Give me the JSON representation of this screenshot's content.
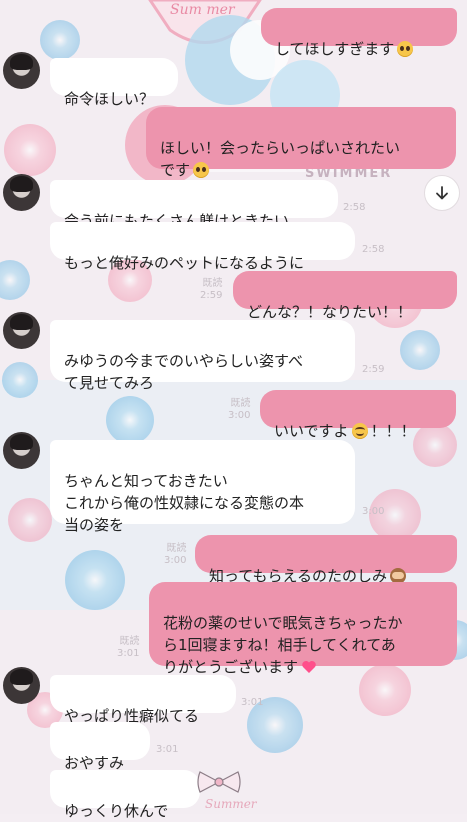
{
  "background": {
    "sticker_text_1": "Sum mer",
    "sticker_text_2": "SWIMMER",
    "sticker_text_3": "Summer"
  },
  "chat": {
    "messages": [
      {
        "id": "m1",
        "side": "out",
        "text": "してほしすぎます",
        "emoji": "pleading-face-icon"
      },
      {
        "id": "m2",
        "side": "in",
        "text": "命令ほしい？"
      },
      {
        "id": "m3",
        "side": "out",
        "text": "ほしい！会ったらいっぱいされたい\nです",
        "emoji": "pleading-face-icon"
      },
      {
        "id": "m4",
        "side": "in",
        "text": "会う前にもたくさん躾けときたい",
        "time": "2:58"
      },
      {
        "id": "m5",
        "side": "in",
        "text": "もっと俺好みのペットになるように",
        "time": "2:58"
      },
      {
        "id": "m6",
        "side": "out",
        "text": "どんな？！なりたい！！",
        "read": "既読",
        "time": "2:59"
      },
      {
        "id": "m7",
        "side": "in",
        "text": "みゆうの今までのいやらしい姿すべ\nて見せてみろ",
        "time": "2:59"
      },
      {
        "id": "m8",
        "side": "out",
        "text": "いいですよ",
        "emoji": "smiling-face-icon",
        "text_after": "！！！",
        "read": "既読",
        "time": "3:00"
      },
      {
        "id": "m9",
        "side": "in",
        "text": "ちゃんと知っておきたい\nこれから俺の性奴隷になる変態の本\n当の姿を",
        "time": "3:00"
      },
      {
        "id": "m10",
        "side": "out",
        "text": "知ってもらえるのたのしみ",
        "emoji": "see-no-evil-monkey-icon",
        "read": "既読",
        "time": "3:00"
      },
      {
        "id": "m11",
        "side": "out",
        "text": "花粉の薬のせいで眠気きちゃったか\nら1回寝ますね！相手してくれてあ\nりがとうございます",
        "emoji": "pink-heart-icon",
        "read": "既読",
        "time": "3:01"
      },
      {
        "id": "m12",
        "side": "in",
        "text": "やっぱり性癖似てる",
        "time": "3:01"
      },
      {
        "id": "m13",
        "side": "in",
        "text": "おやすみ",
        "time": "3:01"
      },
      {
        "id": "m14",
        "side": "in",
        "text": "ゆっくり休んで"
      }
    ]
  },
  "colors": {
    "outgoing_bubble": "#ed94ad",
    "incoming_bubble": "#ffffff",
    "heart": "#ff4f8b"
  }
}
